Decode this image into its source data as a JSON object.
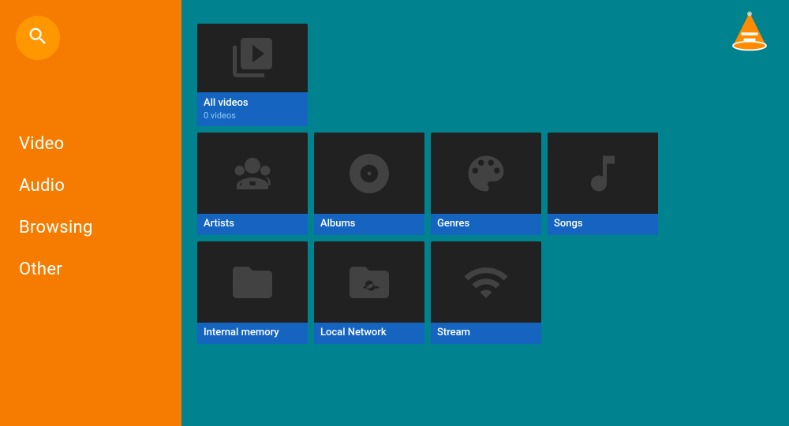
{
  "sidebar": {
    "nav_items": [
      {
        "id": "video",
        "label": "Video"
      },
      {
        "id": "audio",
        "label": "Audio"
      },
      {
        "id": "browsing",
        "label": "Browsing"
      },
      {
        "id": "other",
        "label": "Other"
      }
    ]
  },
  "main": {
    "all_videos": {
      "title": "All videos",
      "subtitle": "0 videos"
    },
    "audio_tiles": [
      {
        "id": "artists",
        "label": "Artists"
      },
      {
        "id": "albums",
        "label": "Albums"
      },
      {
        "id": "genres",
        "label": "Genres"
      },
      {
        "id": "songs",
        "label": "Songs"
      }
    ],
    "browsing_tiles": [
      {
        "id": "internal-memory",
        "label": "Internal memory"
      },
      {
        "id": "local-network",
        "label": "Local Network"
      },
      {
        "id": "stream",
        "label": "Stream"
      }
    ]
  }
}
